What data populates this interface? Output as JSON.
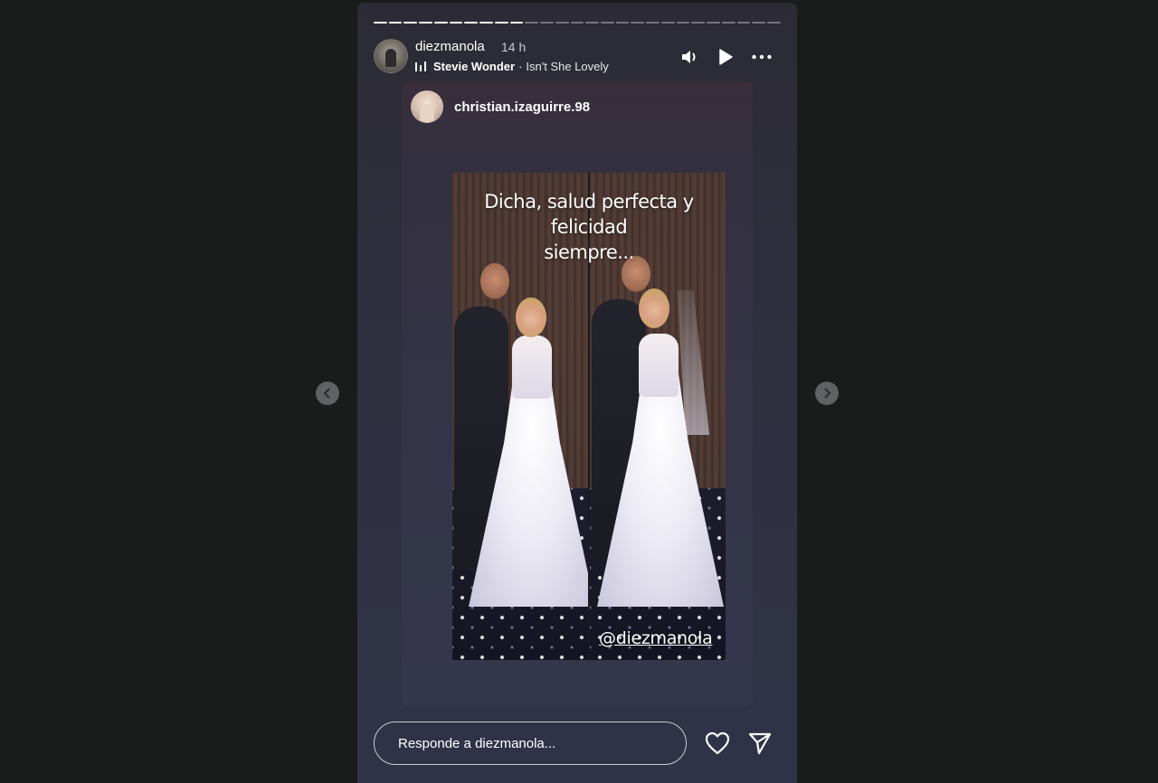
{
  "story": {
    "progress": {
      "segments": 27,
      "completed": 10
    },
    "author": {
      "username": "diezmanola",
      "time": "14 h"
    },
    "music": {
      "artist": "Stevie Wonder",
      "separator": "·",
      "song": "Isn't She Lovely"
    },
    "controls": {
      "mute_icon": "volume-icon",
      "play_icon": "play-icon",
      "more_icon": "more-icon"
    }
  },
  "shared_post": {
    "username": "christian.izaguirre.98",
    "caption_line1": "Dicha, salud perfecta y felicidad",
    "caption_line2": "siempre...",
    "mention": "@diezmanola"
  },
  "navigation": {
    "prev_icon": "chevron-left-icon",
    "next_icon": "chevron-right-icon"
  },
  "reply": {
    "placeholder": "Responde a diezmanola...",
    "like_icon": "heart-icon",
    "share_icon": "send-icon"
  },
  "colors": {
    "background": "#1a1c1b",
    "story_bg": "#2f2f3f",
    "text": "#ffffff"
  }
}
